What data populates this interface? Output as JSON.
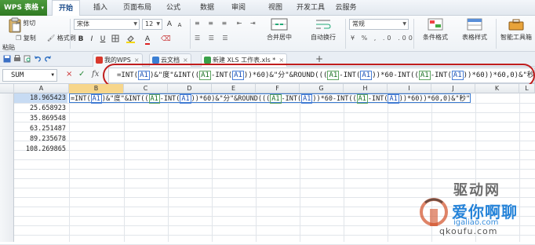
{
  "app": {
    "name": "WPS 表格",
    "dropdown_arrow": "▾"
  },
  "menu": [
    "开始",
    "插入",
    "页面布局",
    "公式",
    "数据",
    "审阅",
    "视图",
    "开发工具",
    "云服务"
  ],
  "ribbon": {
    "cut": "剪切",
    "paste": "粘贴",
    "copy": "复制",
    "format_painter": "格式刷",
    "font_name": "宋体",
    "font_size": "12",
    "merge_center": "合并居中",
    "wrap_text": "自动换行",
    "number_format": "常规",
    "conditional_format": "条件格式",
    "table_style": "表格样式",
    "smart_toolbox": "智能工具箱"
  },
  "doc_tabs": [
    {
      "label": "我的WPS",
      "color": "#d9382c",
      "active": false
    },
    {
      "label": "云文档",
      "color": "#3b7fd4",
      "active": false
    },
    {
      "label": "新建 XLS 工作表.xls *",
      "color": "#3aa14a",
      "active": true
    }
  ],
  "new_tab": "+",
  "formula_bar": {
    "name_box": "SUM",
    "cancel": "×",
    "confirm": "✓",
    "fx": "fx",
    "parts": [
      {
        "t": "=INT(",
        "c": ""
      },
      {
        "t": "A1",
        "c": "a"
      },
      {
        "t": ")&\"度\"&INT((",
        "c": ""
      },
      {
        "t": "A1",
        "c": "b"
      },
      {
        "t": "-INT(",
        "c": ""
      },
      {
        "t": "A1",
        "c": "a"
      },
      {
        "t": "))*60)&\"分\"&ROUND(((",
        "c": ""
      },
      {
        "t": "A1",
        "c": "b"
      },
      {
        "t": "-INT(",
        "c": ""
      },
      {
        "t": "A1",
        "c": "a"
      },
      {
        "t": "))*60-INT((",
        "c": ""
      },
      {
        "t": "A1",
        "c": "b"
      },
      {
        "t": "-INT(",
        "c": ""
      },
      {
        "t": "A1",
        "c": "a"
      },
      {
        "t": "))*60))*60,0)&\"秒\"",
        "c": ""
      }
    ]
  },
  "columns": [
    "A",
    "B",
    "C",
    "D",
    "E",
    "F",
    "G",
    "H",
    "I",
    "J",
    "K",
    "L"
  ],
  "active_column": "B",
  "cells_A": [
    "18.965423",
    "25.658923",
    "35.869548",
    "63.251487",
    "89.235678",
    "108.269865"
  ],
  "watermark": {
    "brand": "驱动网",
    "brand2": "爱你啊聊",
    "url": "qkoufu.com",
    "url2": "igaliao.com"
  }
}
